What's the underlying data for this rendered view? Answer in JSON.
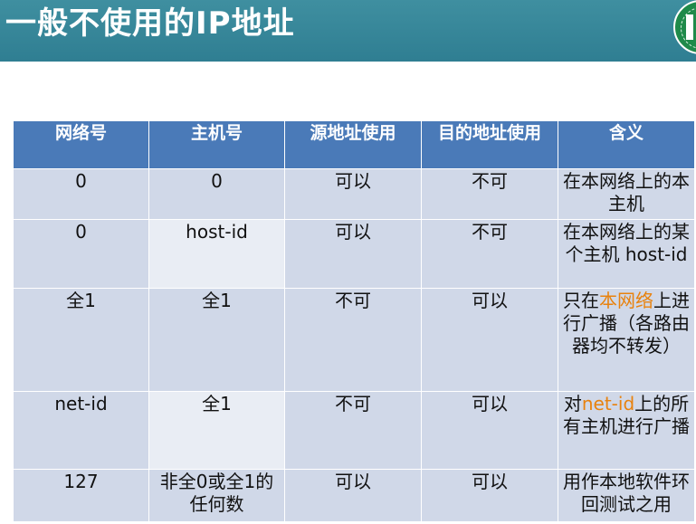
{
  "slide": {
    "title": "一般不使用的IP地址"
  },
  "colors": {
    "title_bar": "#2f7e92",
    "header_bg": "#4a7ab8",
    "row_dark": "#d0d8e8",
    "row_light": "#e9edf4",
    "highlight": "#e8820e",
    "logo_green": "#1f8a4a"
  },
  "logo": {
    "icon": "university-seal-icon"
  },
  "table": {
    "headers": [
      "网络号",
      "主机号",
      "源地址使用",
      "目的地址使用",
      "含义"
    ],
    "rows": [
      {
        "network": "0",
        "host": "0",
        "source": "可以",
        "destination": "不可",
        "meaning": {
          "pre": "在本网络上的本主机",
          "hl": "",
          "post": ""
        }
      },
      {
        "network": "0",
        "host": "host-id",
        "source": "可以",
        "destination": "不可",
        "meaning": {
          "pre": "在本网络上的某个主机 host-id",
          "hl": "",
          "post": ""
        }
      },
      {
        "network": "全1",
        "host": "全1",
        "source": "不可",
        "destination": "可以",
        "meaning": {
          "pre": "只在",
          "hl": "本网络",
          "post": "上进行广播（各路由器均不转发）"
        }
      },
      {
        "network": "net-id",
        "host": "全1",
        "source": "不可",
        "destination": "可以",
        "meaning": {
          "pre": "对",
          "hl": "net-id",
          "post": "上的所有主机进行广播"
        }
      },
      {
        "network": "127",
        "host": "非全0或全1的任何数",
        "source": "可以",
        "destination": "可以",
        "meaning": {
          "pre": "用作本地软件环回测试之用",
          "hl": "",
          "post": ""
        }
      }
    ]
  }
}
